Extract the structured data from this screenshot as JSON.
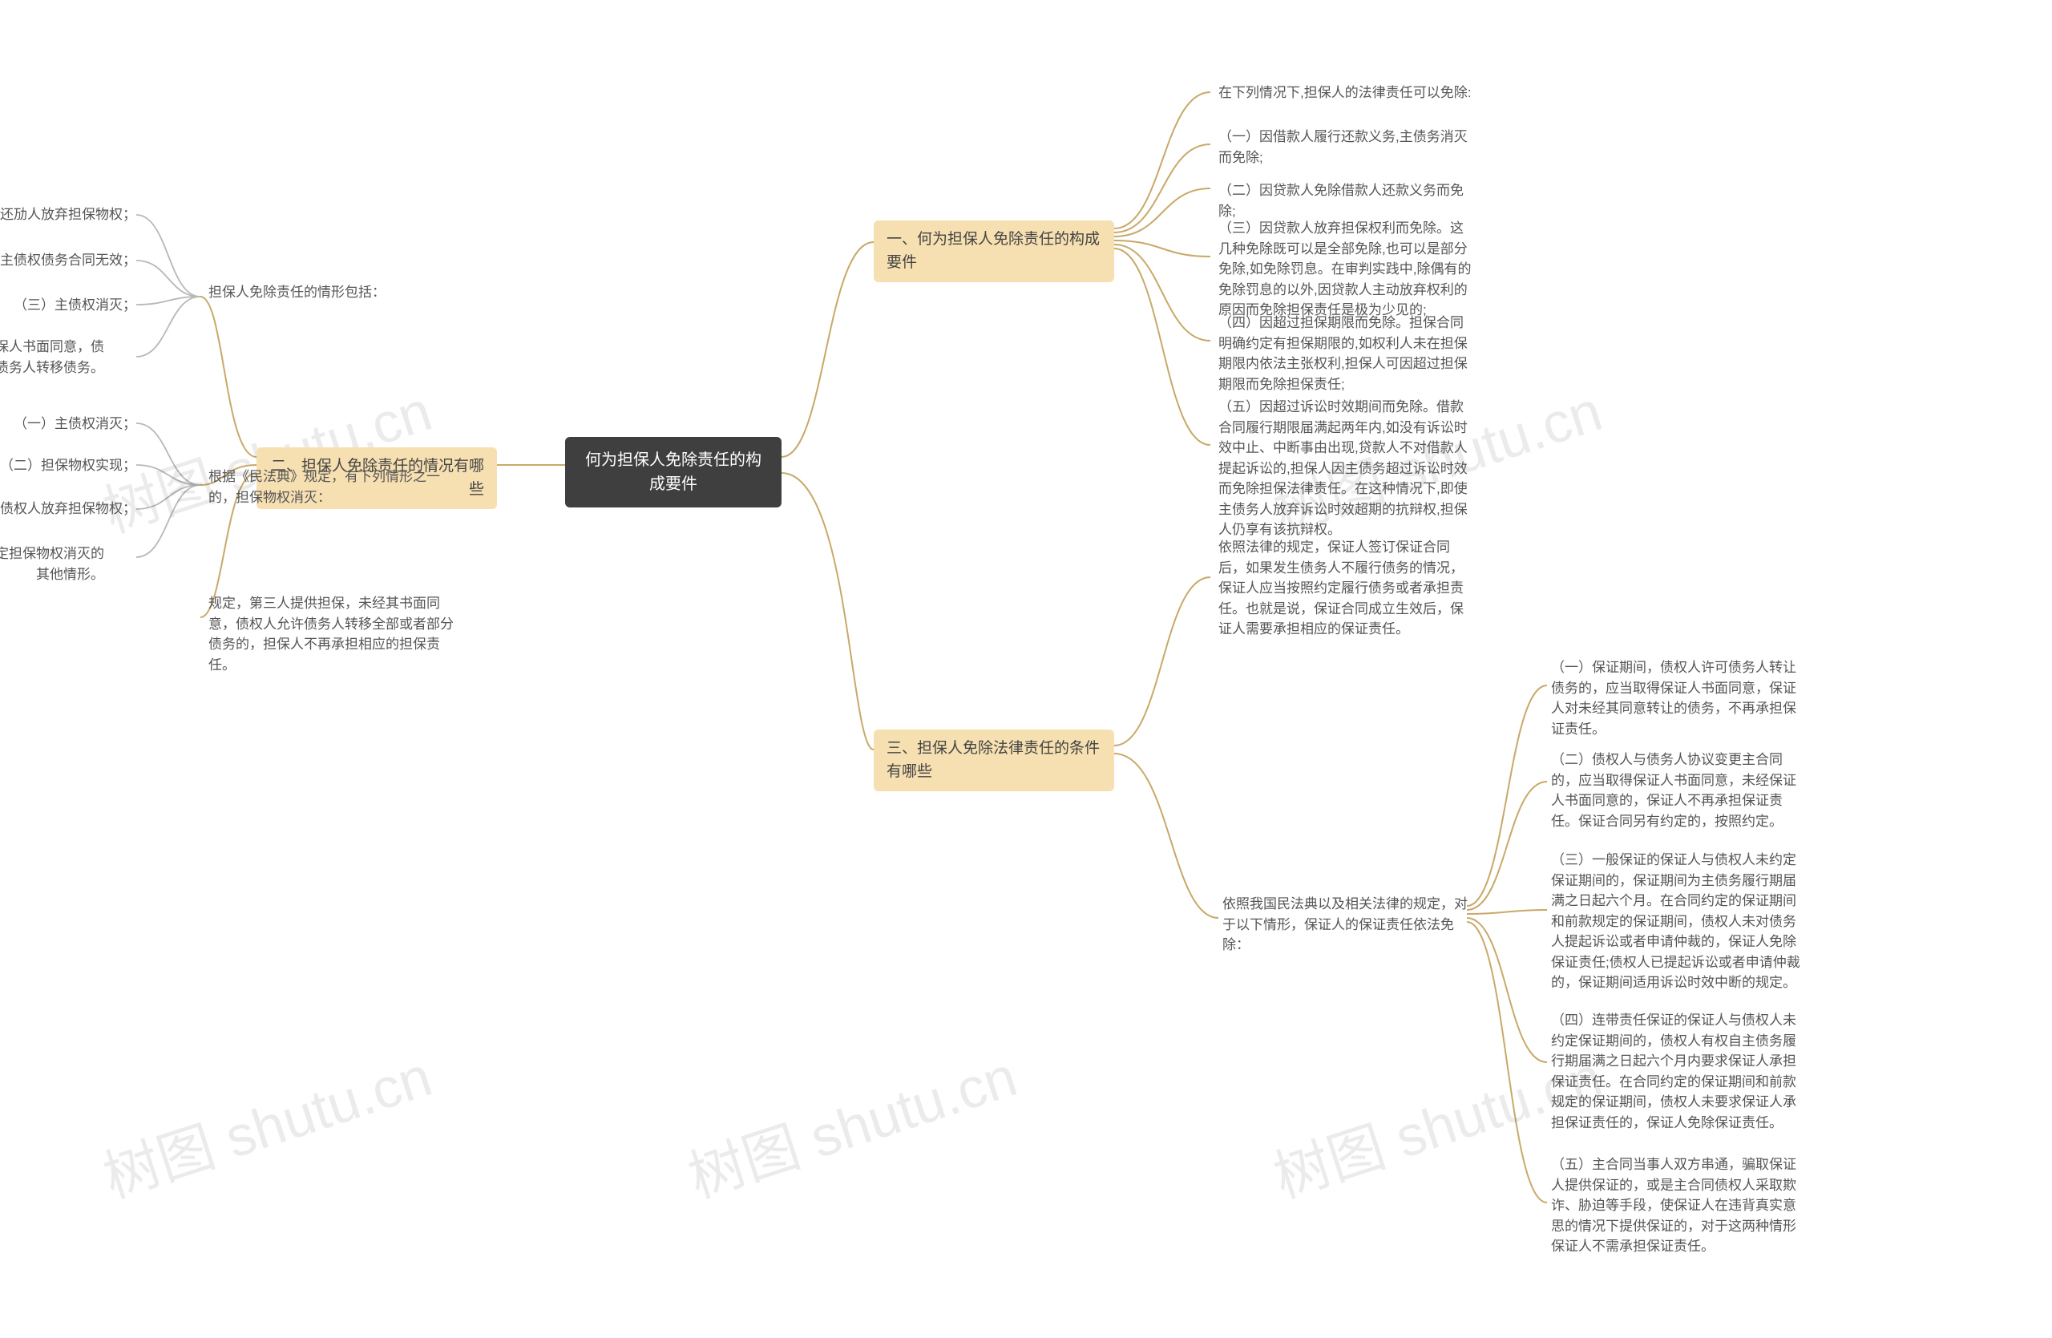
{
  "root": {
    "title": "何为担保人免除责任的构成要件"
  },
  "branch1": {
    "title": "一、何为担保人免除责任的构成要件",
    "intro": "在下列情况下,担保人的法律责任可以免除:",
    "items": [
      "（一）因借款人履行还款义务,主债务消灭而免除;",
      "（二）因贷款人免除借款人还款义务而免除;",
      "（三）因贷款人放弃担保权利而免除。这几种免除既可以是全部免除,也可以是部分免除,如免除罚息。在审判实践中,除偶有的免除罚息的以外,因贷款人主动放弃权利的原因而免除担保责任是极为少见的;",
      "（四）因超过担保期限而免除。担保合同明确约定有担保期限的,如权利人未在担保期限内依法主张权利,担保人可因超过担保期限而免除担保责任;",
      "（五）因超过诉讼时效期间而免除。借款合同履行期限届满起两年内,如没有诉讼时效中止、中断事由出现,贷款人不对借款人提起诉讼的,担保人因主债务超过诉讼时效而免除担保法律责任。在这种情况下,即使主债务人放弃诉讼时效超期的抗辩权,担保人仍享有该抗辩权。"
    ]
  },
  "branch2": {
    "title": "二、担保人免除责任的情况有哪些",
    "sub1": {
      "title": "担保人免除责任的情形包括：",
      "items": [
        "（一）还劢人放弃担保物权；",
        "（二）主债权债务合同无效；",
        "（三）主债权消灭；",
        "（四）未经担保人书面同意，债权人允许债务人转移债务。"
      ]
    },
    "sub2": {
      "title": "根据《民法典》规定，有下列情形之一的，担保物权消灭：",
      "items": [
        "（一）主债权消灭；",
        "（二）担保物权实现；",
        "（三）债权人放弃担保物权；",
        "（四）法律规定担保物权消灭的其他情形。"
      ]
    },
    "sub3": {
      "text": "规定，第三人提供担保，未经其书面同意，债权人允许债务人转移全部或者部分债务的，担保人不再承担相应的担保责任。"
    }
  },
  "branch3": {
    "title": "三、担保人免除法律责任的条件有哪些",
    "intro": "依照法律的规定，保证人签订保证合同后，如果发生债务人不履行债务的情况，保证人应当按照约定履行债务或者承担责任。也就是说，保证合同成立生效后，保证人需要承担相应的保证责任。",
    "sub": {
      "title": "依照我国民法典以及相关法律的规定，对于以下情形，保证人的保证责任依法免除：",
      "items": [
        "（一）保证期间，债权人许可债务人转让债务的，应当取得保证人书面同意，保证人对未经其同意转让的债务，不再承担保证责任。",
        "（二）债权人与债务人协议变更主合同的，应当取得保证人书面同意，未经保证人书面同意的，保证人不再承担保证责任。保证合同另有约定的，按照约定。",
        "（三）一般保证的保证人与债权人未约定保证期间的，保证期间为主债务履行期届满之日起六个月。在合同约定的保证期间和前款规定的保证期间，债权人未对债务人提起诉讼或者申请仲裁的，保证人免除保证责任;债权人已提起诉讼或者申请仲裁的，保证期间适用诉讼时效中断的规定。",
        "（四）连带责任保证的保证人与债权人未约定保证期间的，债权人有权自主债务履行期届满之日起六个月内要求保证人承担保证责任。在合同约定的保证期间和前款规定的保证期间，债权人未要求保证人承担保证责任的，保证人免除保证责任。",
        "（五）主合同当事人双方串通，骗取保证人提供保证的，或是主合同债权人采取欺诈、胁迫等手段，使保证人在违背真实意思的情况下提供保证的，对于这两种情形保证人不需承担保证责任。"
      ]
    }
  },
  "watermark": "树图 shutu.cn"
}
